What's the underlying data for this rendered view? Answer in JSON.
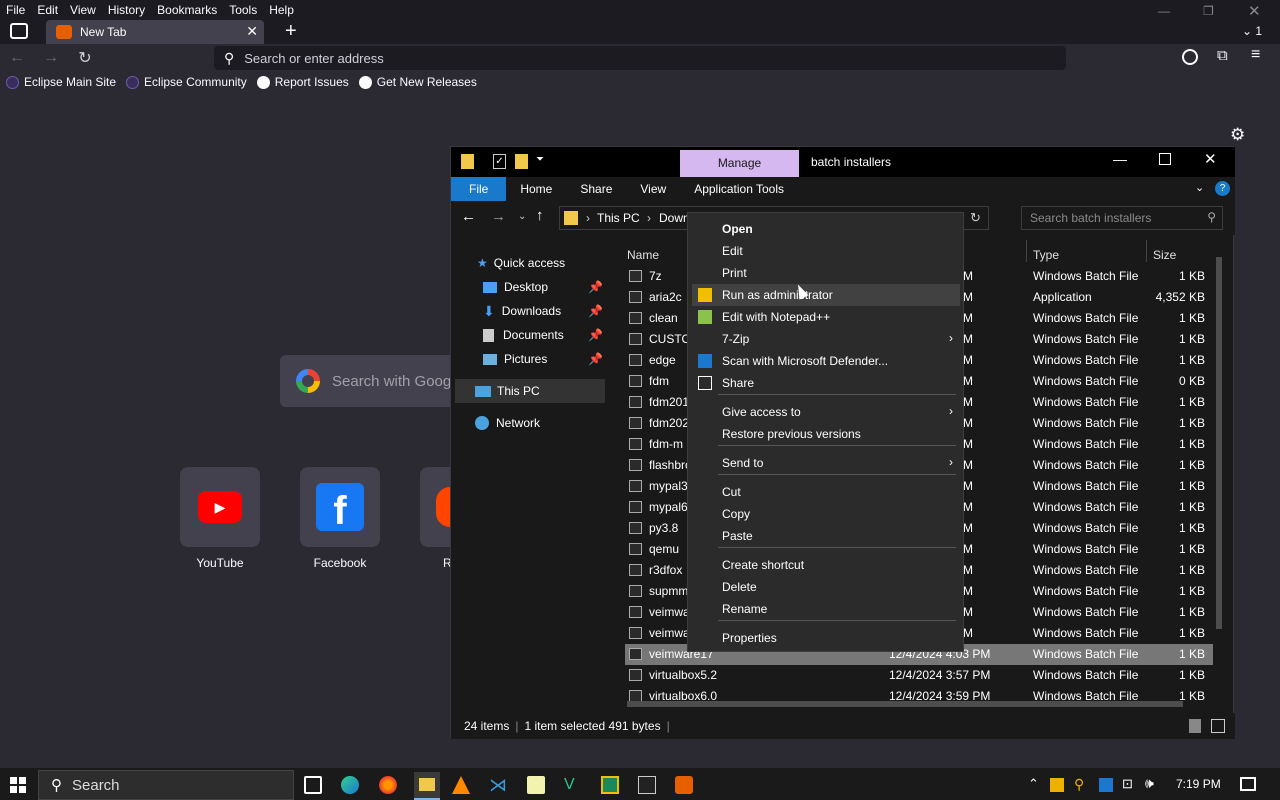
{
  "browser": {
    "menu": [
      "File",
      "Edit",
      "View",
      "History",
      "Bookmarks",
      "Tools",
      "Help"
    ],
    "tab_title": "New Tab",
    "tab_count": "1",
    "address_placeholder": "Search or enter address",
    "bookmarks": [
      "Eclipse Main Site",
      "Eclipse Community",
      "Report Issues",
      "Get New Releases"
    ]
  },
  "newtab": {
    "search_placeholder": "Search with Goog",
    "shortcuts": [
      {
        "label": "YouTube",
        "color": "#ff0000"
      },
      {
        "label": "Facebook",
        "color": "#1877f2"
      },
      {
        "label": "R",
        "color": "#ff4500"
      }
    ]
  },
  "explorer": {
    "title_manage": "Manage",
    "title": "batch installers",
    "ribbon_tabs": [
      "File",
      "Home",
      "Share",
      "View",
      "Application Tools"
    ],
    "breadcrumb": [
      "This PC",
      "Down"
    ],
    "search_placeholder": "Search batch installers",
    "nav": {
      "quick_access": "Quick access",
      "items": [
        "Desktop",
        "Downloads",
        "Documents",
        "Pictures"
      ],
      "this_pc": "This PC",
      "network": "Network"
    },
    "columns": {
      "name": "Name",
      "type": "Type",
      "size": "Size"
    },
    "files": [
      {
        "name": "7z",
        "date": "PM",
        "type": "Windows Batch File",
        "size": "1 KB"
      },
      {
        "name": "aria2c",
        "date": "PM",
        "type": "Application",
        "size": "4,352 KB"
      },
      {
        "name": "clean",
        "date": "PM",
        "type": "Windows Batch File",
        "size": "1 KB"
      },
      {
        "name": "CUSTOM",
        "date": "PM",
        "type": "Windows Batch File",
        "size": "1 KB"
      },
      {
        "name": "edge",
        "date": "PM",
        "type": "Windows Batch File",
        "size": "1 KB"
      },
      {
        "name": "fdm",
        "date": "PM",
        "type": "Windows Batch File",
        "size": "0 KB"
      },
      {
        "name": "fdm201",
        "date": "PM",
        "type": "Windows Batch File",
        "size": "1 KB"
      },
      {
        "name": "fdm202",
        "date": "PM",
        "type": "Windows Batch File",
        "size": "1 KB"
      },
      {
        "name": "fdm-m",
        "date": "PM",
        "type": "Windows Batch File",
        "size": "1 KB"
      },
      {
        "name": "flashbro",
        "date": "PM",
        "type": "Windows Batch File",
        "size": "1 KB"
      },
      {
        "name": "mypal3",
        "date": "PM",
        "type": "Windows Batch File",
        "size": "1 KB"
      },
      {
        "name": "mypal6",
        "date": "PM",
        "type": "Windows Batch File",
        "size": "1 KB"
      },
      {
        "name": "py3.8",
        "date": "PM",
        "type": "Windows Batch File",
        "size": "1 KB"
      },
      {
        "name": "qemu",
        "date": "PM",
        "type": "Windows Batch File",
        "size": "1 KB"
      },
      {
        "name": "r3dfox",
        "date": "PM",
        "type": "Windows Batch File",
        "size": "1 KB"
      },
      {
        "name": "supmm",
        "date": "PM",
        "type": "Windows Batch File",
        "size": "1 KB"
      },
      {
        "name": "veimwa",
        "date": "PM",
        "type": "Windows Batch File",
        "size": "1 KB"
      },
      {
        "name": "veimwa",
        "date": "PM",
        "type": "Windows Batch File",
        "size": "1 KB"
      },
      {
        "name": "veimware17",
        "date": "12/4/2024 4:03 PM",
        "type": "Windows Batch File",
        "size": "1 KB"
      },
      {
        "name": "virtualbox5.2",
        "date": "12/4/2024 3:57 PM",
        "type": "Windows Batch File",
        "size": "1 KB"
      },
      {
        "name": "virtualbox6.0",
        "date": "12/4/2024 3:59 PM",
        "type": "Windows Batch File",
        "size": "1 KB"
      }
    ],
    "status": {
      "items": "24 items",
      "selected": "1 item selected  491 bytes"
    }
  },
  "context_menu": {
    "items": [
      {
        "label": "Open",
        "bold": true
      },
      {
        "label": "Edit"
      },
      {
        "label": "Print"
      },
      {
        "label": "Run as administrator"
      },
      {
        "label": "Edit with Notepad++"
      },
      {
        "label": "7-Zip",
        "submenu": true
      },
      {
        "label": "Scan with Microsoft Defender..."
      },
      {
        "label": "Share"
      },
      {
        "label": "Give access to",
        "submenu": true
      },
      {
        "label": "Restore previous versions"
      },
      {
        "label": "Send to",
        "submenu": true
      },
      {
        "label": "Cut"
      },
      {
        "label": "Copy"
      },
      {
        "label": "Paste"
      },
      {
        "label": "Create shortcut"
      },
      {
        "label": "Delete"
      },
      {
        "label": "Rename"
      },
      {
        "label": "Properties"
      }
    ]
  },
  "taskbar": {
    "search": "Search",
    "time": "7:19 PM"
  }
}
